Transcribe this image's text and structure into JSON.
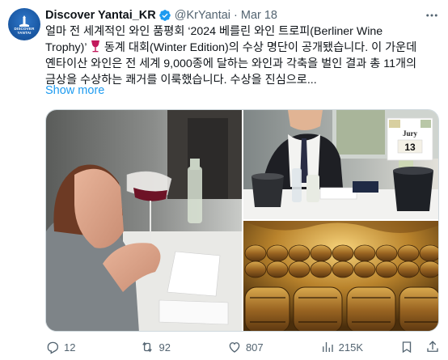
{
  "account": {
    "display_name": "Discover Yantai_KR",
    "handle": "@KrYantai",
    "separator": "·",
    "date": "Mar 18",
    "avatar_text": "DISCOVER\nYANTAI",
    "verified_color": "#1d9bf0"
  },
  "tweet": {
    "line1": "얼마 전 세계적인 와인 품평회 ‘2024 베를린 와인 트로피(Berliner Wine",
    "line2a": "Trophy)’ ",
    "emoji_icon": "wine-glass-icon",
    "line2b": " 동계 대회(Winter Edition)의 수상 명단이 공개됐습니다. 이 가운데",
    "line3": "옌타이산 와인은 전 세계 9,000종에 달하는 와인과 각축을 벌인 결과 총 11개의",
    "line4": "금상을 수상하는 쾌거를 이룩했습니다. 수상을 진심으로...",
    "show_more": "Show more"
  },
  "media": {
    "jury_card_title": "Jury",
    "jury_card_number": "13"
  },
  "actions": {
    "replies": "12",
    "reposts": "92",
    "likes": "807",
    "views": "215K"
  },
  "colors": {
    "link": "#1d9bf0",
    "secondary_text": "#536471",
    "accent_wine": "#c2185b"
  }
}
